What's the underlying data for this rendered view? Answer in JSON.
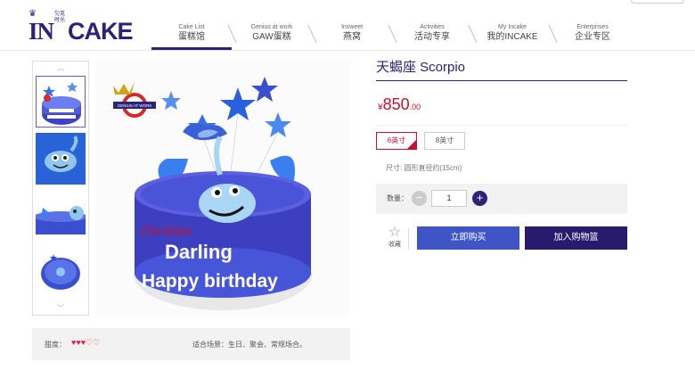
{
  "brand": {
    "crown": "♛",
    "in": "IN",
    "cn": "匀克时光",
    "cake": "CAKE"
  },
  "nav": [
    {
      "en": "Cake List",
      "zh": "蛋糕馆",
      "active": true
    },
    {
      "en": "Genius at work",
      "zh": "GAW蛋糕"
    },
    {
      "en": "Insweet",
      "zh": "燕窝"
    },
    {
      "en": "Activities",
      "zh": "活动专享"
    },
    {
      "en": "My Incake",
      "zh": "我的INCAKE"
    },
    {
      "en": "Enterprises",
      "zh": "企业专区"
    }
  ],
  "product": {
    "title": "天蝎座 Scorpio",
    "price_symbol": "¥",
    "price_int": "850",
    "price_dec": ".00",
    "sizes": [
      "6英寸",
      "8英寸"
    ],
    "selected_size": "6英寸",
    "size_desc": "尺寸: 圆形直径约(15cm)",
    "qty_label": "数量：",
    "qty_value": "1",
    "fav_label": "收藏",
    "buy_now": "立即购买",
    "add_cart": "加入购物篮",
    "image_badge": "GENIUS AT WORK",
    "cake_text_1": "Darling",
    "cake_text_2": "Happy birthday"
  },
  "details": {
    "sweet_label": "甜度：",
    "sweet_rating": 3,
    "sweet_max": 5,
    "occasion": "适合场景：生日、聚会、常规场合。"
  },
  "colors": {
    "brand": "#2a2377",
    "price": "#c8102e",
    "buy": "#3f55c5",
    "cart": "#2a1a6e"
  }
}
